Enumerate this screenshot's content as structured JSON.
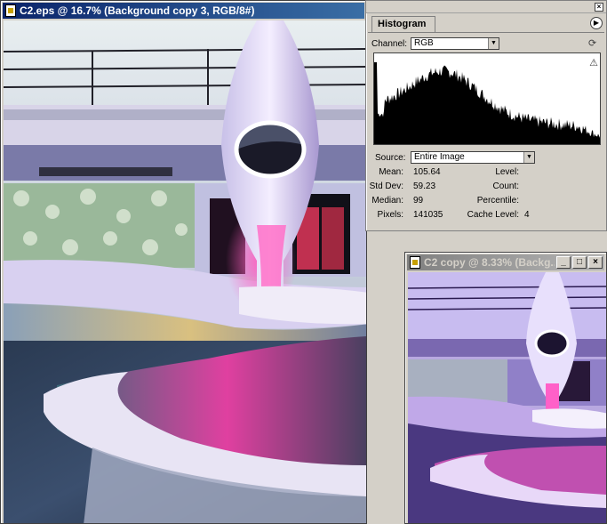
{
  "main_window": {
    "title": "C2.eps @ 16.7% (Background copy 3, RGB/8#)"
  },
  "copy_window": {
    "title": "C2 copy @ 8.33% (Backg..."
  },
  "histogram": {
    "tab_label": "Histogram",
    "channel_label": "Channel:",
    "channel_value": "RGB",
    "source_label": "Source:",
    "source_value": "Entire Image",
    "stats": {
      "mean_label": "Mean:",
      "mean": "105.64",
      "std_dev_label": "Std Dev:",
      "std_dev": "59.23",
      "median_label": "Median:",
      "median": "99",
      "pixels_label": "Pixels:",
      "pixels": "141035",
      "level_label": "Level:",
      "count_label": "Count:",
      "percentile_label": "Percentile:",
      "cache_level_label": "Cache Level:",
      "cache_level": "4"
    },
    "colors": {
      "fill": "#000000"
    }
  }
}
